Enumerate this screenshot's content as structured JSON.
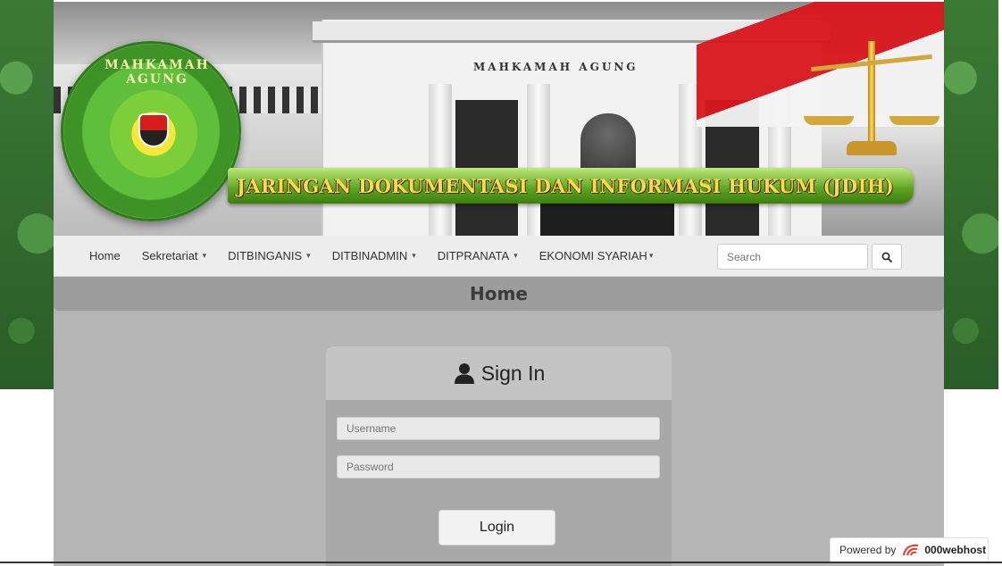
{
  "banner": {
    "building_text": "MAHKAMAH AGUNG",
    "seal_text": "MAHKAMAH AGUNG",
    "title": "JARINGAN DOKUMENTASI DAN INFORMASI HUKUM (JDIH)"
  },
  "nav": {
    "items": [
      {
        "label": "Home",
        "dropdown": false
      },
      {
        "label": "Sekretariat",
        "dropdown": true
      },
      {
        "label": "DITBINGANIS",
        "dropdown": true
      },
      {
        "label": "DITBINADMIN",
        "dropdown": true
      },
      {
        "label": "DITPRANATA",
        "dropdown": true
      },
      {
        "label": "EKONOMI SYARIAH",
        "dropdown": true
      }
    ],
    "caret": "▾",
    "search_placeholder": "Search",
    "search_icon": "search-icon"
  },
  "page": {
    "heading": "Home"
  },
  "login": {
    "title": "Sign In",
    "icon": "user-icon",
    "username_placeholder": "Username",
    "password_placeholder": "Password",
    "button": "Login"
  },
  "footer": {
    "powered_by": "Powered by",
    "brand": "000webhost"
  }
}
